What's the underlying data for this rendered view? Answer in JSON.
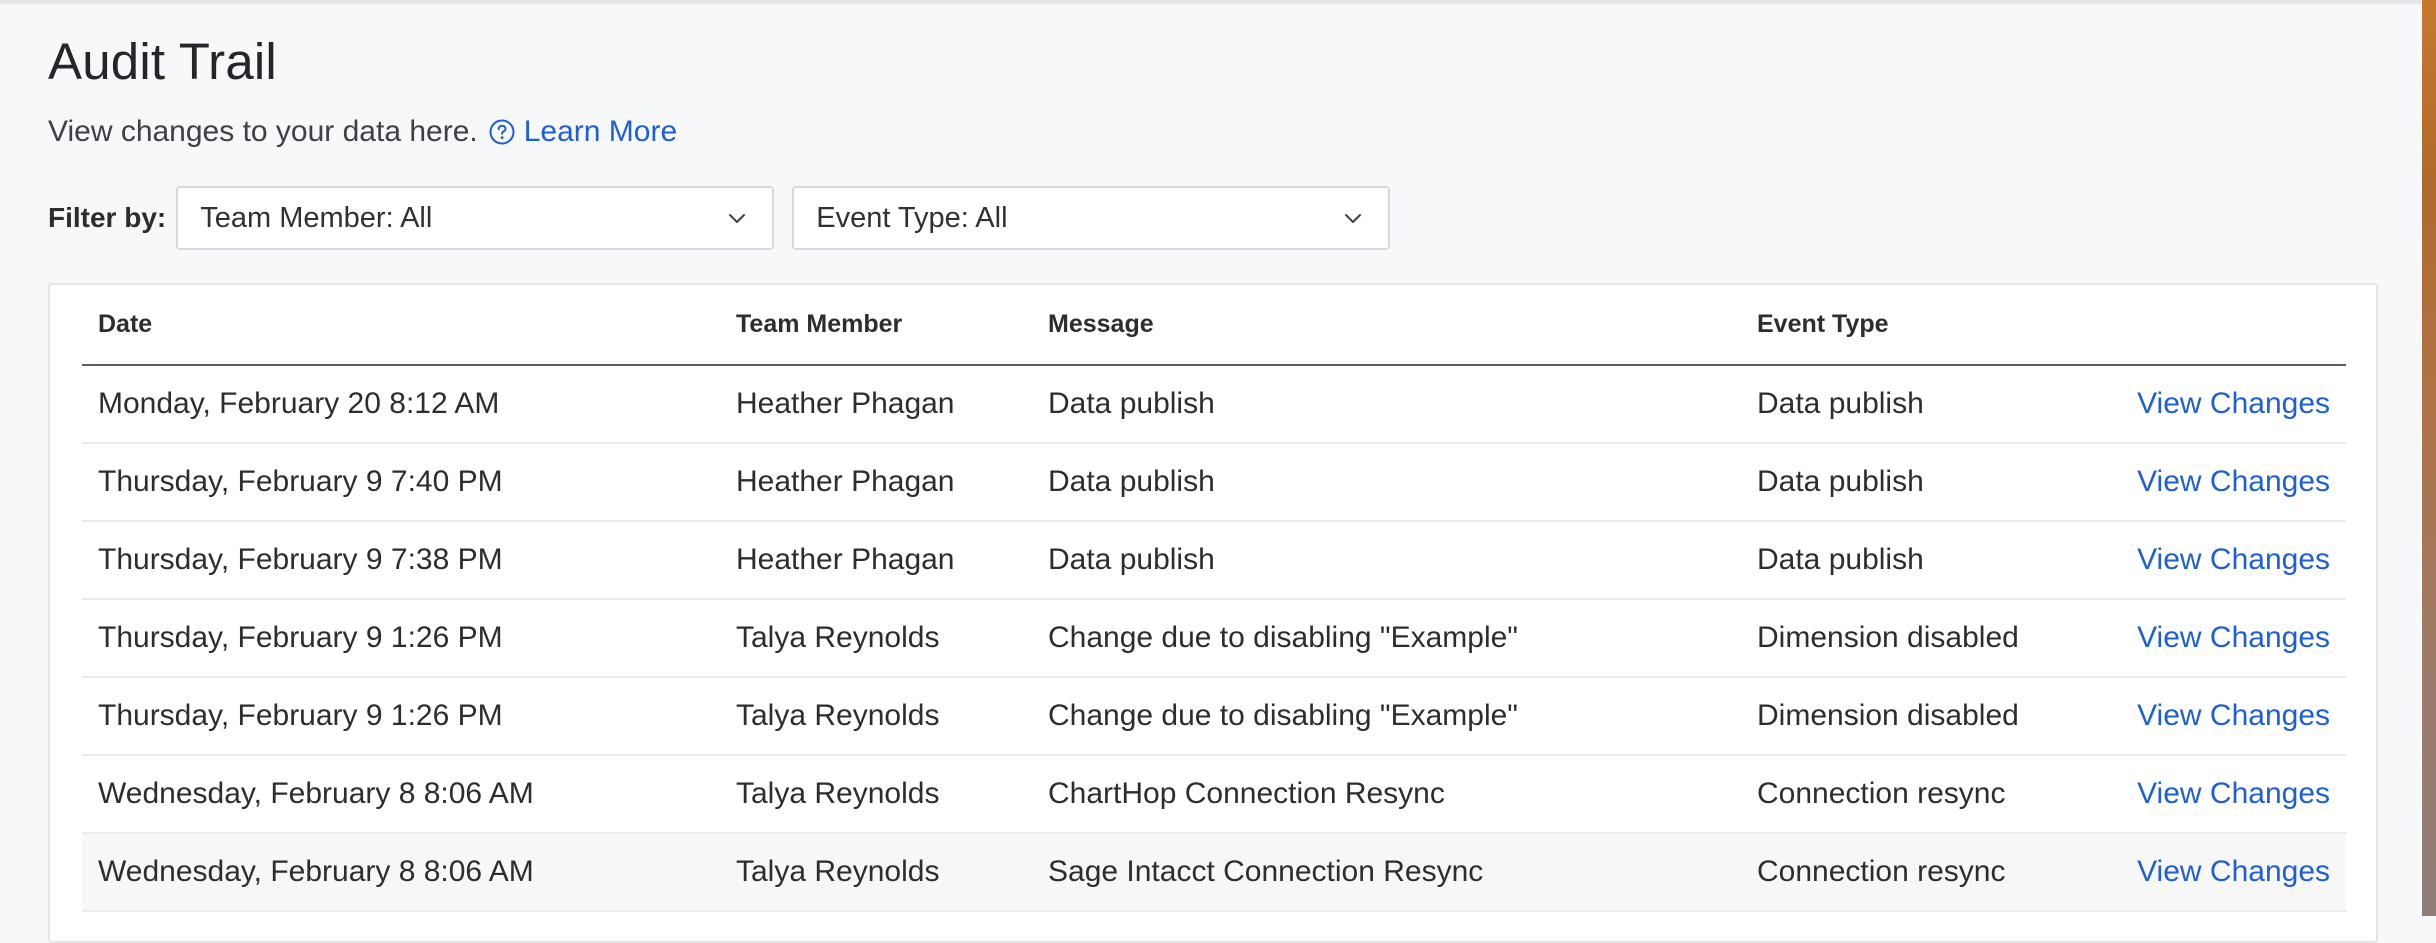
{
  "header": {
    "title": "Audit Trail",
    "subtitle": "View changes to your data here.",
    "learn_more": "Learn More",
    "help_icon": "question-circle-icon"
  },
  "filters": {
    "label": "Filter by:",
    "team_member": "Team Member: All",
    "event_type": "Event Type: All",
    "chevron_icon": "chevron-down-icon"
  },
  "table": {
    "columns": [
      "Date",
      "Team Member",
      "Message",
      "Event Type",
      ""
    ],
    "rows": [
      {
        "date": "Monday, February 20 8:12 AM",
        "member": "Heather Phagan",
        "message": "Data publish",
        "event": "Data publish",
        "action": "View Changes"
      },
      {
        "date": "Thursday, February 9 7:40 PM",
        "member": "Heather Phagan",
        "message": "Data publish",
        "event": "Data publish",
        "action": "View Changes"
      },
      {
        "date": "Thursday, February 9 7:38 PM",
        "member": "Heather Phagan",
        "message": "Data publish",
        "event": "Data publish",
        "action": "View Changes"
      },
      {
        "date": "Thursday, February 9 1:26 PM",
        "member": "Talya Reynolds",
        "message": "Change due to disabling \"Example\"",
        "event": "Dimension disabled",
        "action": "View Changes"
      },
      {
        "date": "Thursday, February 9 1:26 PM",
        "member": "Talya Reynolds",
        "message": "Change due to disabling \"Example\"",
        "event": "Dimension disabled",
        "action": "View Changes"
      },
      {
        "date": "Wednesday, February 8 8:06 AM",
        "member": "Talya Reynolds",
        "message": "ChartHop Connection Resync",
        "event": "Connection resync",
        "action": "View Changes"
      },
      {
        "date": "Wednesday, February 8 8:06 AM",
        "member": "Talya Reynolds",
        "message": "Sage Intacct Connection Resync",
        "event": "Connection resync",
        "action": "View Changes"
      }
    ]
  },
  "colors": {
    "link": "#1f5fcf",
    "background": "#f7f8fa",
    "header_rule": "#5a5d63"
  }
}
